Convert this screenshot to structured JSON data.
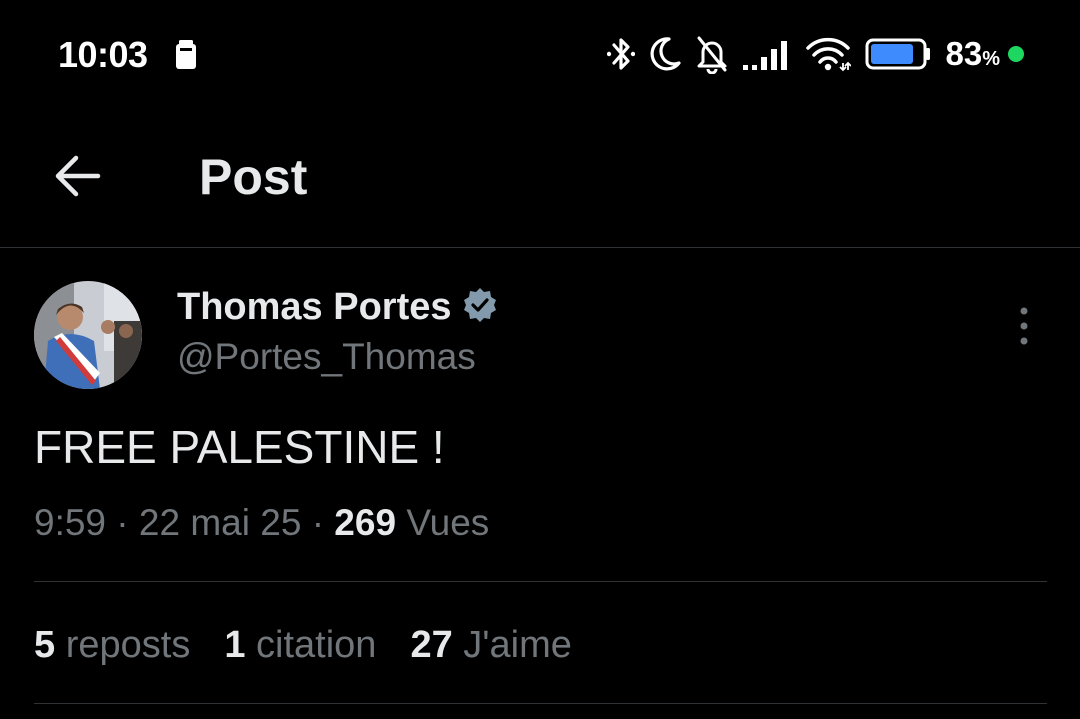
{
  "status_bar": {
    "time": "10:03",
    "battery_percent": "83",
    "battery_unit": "%",
    "battery_level": 0.83,
    "icons": [
      "sim-card-icon",
      "bluetooth-icon",
      "moon-icon",
      "bell-off-icon",
      "signal-icon",
      "wifi-icon",
      "battery-icon",
      "charging-dot-icon"
    ]
  },
  "appbar": {
    "title": "Post"
  },
  "post": {
    "author_name": "Thomas Portes",
    "author_handle": "@Portes_Thomas",
    "verified": true,
    "text": "FREE PALESTINE !",
    "time": "9:59",
    "separator": "·",
    "date": "22 mai 25",
    "views_count": "269",
    "views_label": "Vues",
    "stats": {
      "reposts_count": "5",
      "reposts_label": "reposts",
      "quotes_count": "1",
      "quotes_label": "citation",
      "likes_count": "27",
      "likes_label": "J'aime"
    }
  },
  "colors": {
    "background": "#000000",
    "primary_text": "#e7e9ea",
    "secondary_text": "#71767b",
    "divider": "#2f3336",
    "verified_badge": "#829aab",
    "charging_dot": "#1ed760"
  }
}
